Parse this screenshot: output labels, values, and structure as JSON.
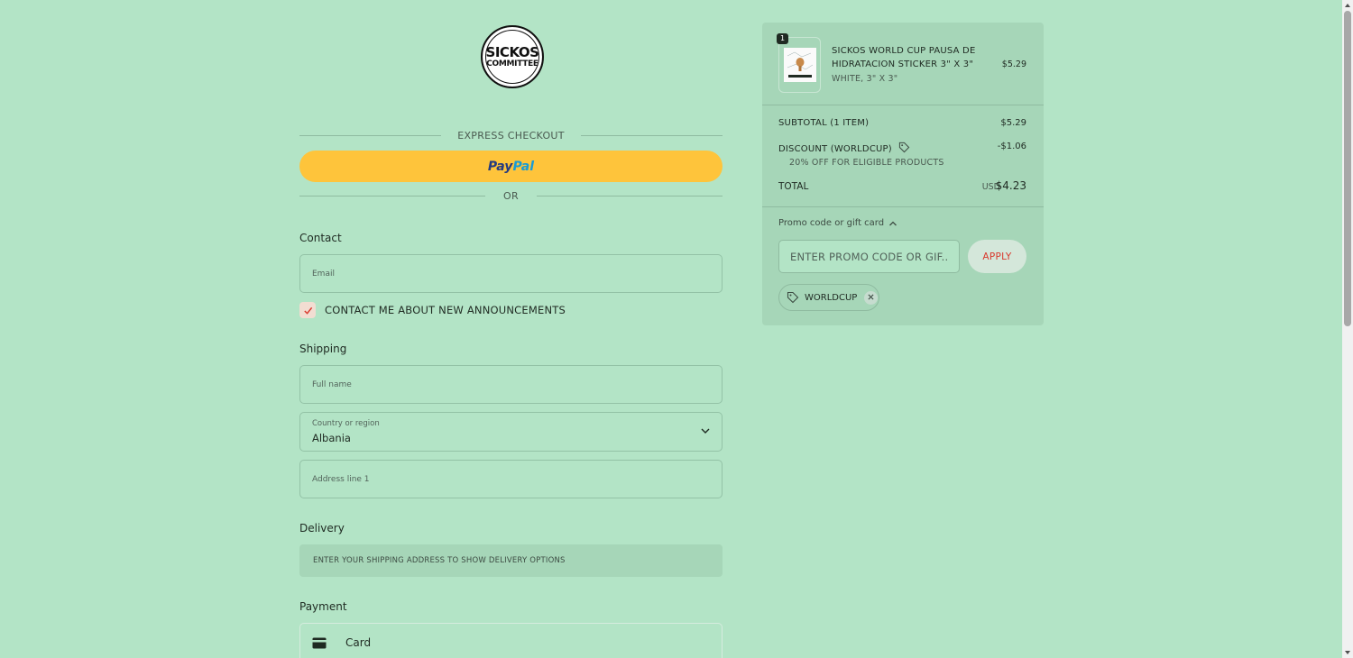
{
  "brand": {
    "logo_line1": "SICKOS",
    "logo_line2": "COMMITTEE"
  },
  "express": {
    "label": "EXPRESS CHECKOUT",
    "paypal_pay": "Pay",
    "paypal_pal": "Pal",
    "or_label": "OR"
  },
  "contact": {
    "title": "Contact",
    "email_placeholder": "Email",
    "newsletter_label": "CONTACT ME ABOUT NEW ANNOUNCEMENTS",
    "newsletter_checked": true
  },
  "shipping": {
    "title": "Shipping",
    "fullname_placeholder": "Full name",
    "country_label": "Country or region",
    "country_value": "Albania",
    "address_placeholder": "Address line 1"
  },
  "delivery": {
    "title": "Delivery",
    "message": "ENTER YOUR SHIPPING ADDRESS TO SHOW DELIVERY OPTIONS"
  },
  "payment": {
    "title": "Payment",
    "card_label": "Card"
  },
  "cart": {
    "item": {
      "quantity": "1",
      "name": "SICKOS WORLD CUP PAUSA DE HIDRATACION STICKER 3\" X 3\"",
      "variant": "WHITE, 3\" X 3\"",
      "price": "$5.29"
    },
    "subtotal_label": "SUBTOTAL (1 ITEM)",
    "subtotal_value": "$5.29",
    "discount_label": "DISCOUNT (WORLDCUP)",
    "discount_value": "-$1.06",
    "discount_note": "20% OFF FOR ELIGIBLE PRODUCTS",
    "total_label": "TOTAL",
    "total_currency": "USD",
    "total_value": "$4.23"
  },
  "promo": {
    "toggle_label": "Promo code or gift card",
    "input_placeholder": "ENTER PROMO CODE OR GIF...",
    "apply_label": "APPLY",
    "applied_code": "WORLDCUP"
  },
  "colors": {
    "background": "#b3e4c6",
    "panel": "#a6d6b8",
    "paypal_yellow": "#fec43b",
    "accent_red": "#d9382c"
  }
}
